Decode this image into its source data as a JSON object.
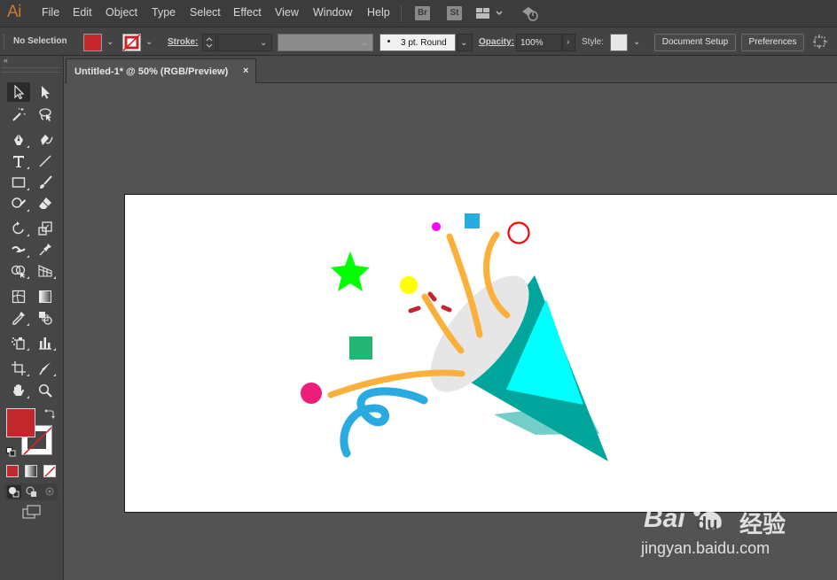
{
  "app": {
    "logo": "Ai"
  },
  "menu": {
    "items": [
      {
        "label": "File"
      },
      {
        "label": "Edit"
      },
      {
        "label": "Object"
      },
      {
        "label": "Type"
      },
      {
        "label": "Select"
      },
      {
        "label": "Effect"
      },
      {
        "label": "View"
      },
      {
        "label": "Window"
      },
      {
        "label": "Help"
      }
    ],
    "bridge_label": "Br",
    "stock_label": "St"
  },
  "control_bar": {
    "selection_status": "No Selection",
    "fill_color": "#c1272d",
    "stroke_label": "Stroke:",
    "brush_label": "3 pt. Round",
    "opacity_label": "Opacity:",
    "opacity_value": "100%",
    "style_label": "Style:",
    "document_setup_label": "Document Setup",
    "preferences_label": "Preferences"
  },
  "tools_panel": {
    "fill_color": "#c1272d",
    "tools": [
      {
        "name": "selection-tool"
      },
      {
        "name": "direct-selection-tool"
      },
      {
        "name": "magic-wand-tool"
      },
      {
        "name": "lasso-tool"
      },
      {
        "name": "pen-tool"
      },
      {
        "name": "curvature-tool"
      },
      {
        "name": "type-tool"
      },
      {
        "name": "line-segment-tool"
      },
      {
        "name": "rectangle-tool"
      },
      {
        "name": "paintbrush-tool"
      },
      {
        "name": "shaper-tool"
      },
      {
        "name": "eraser-tool"
      },
      {
        "name": "rotate-tool"
      },
      {
        "name": "scale-tool"
      },
      {
        "name": "width-tool"
      },
      {
        "name": "puppet-warp-tool"
      },
      {
        "name": "shape-builder-tool"
      },
      {
        "name": "perspective-grid-tool"
      },
      {
        "name": "mesh-tool"
      },
      {
        "name": "gradient-tool"
      },
      {
        "name": "eyedropper-tool"
      },
      {
        "name": "blend-tool"
      },
      {
        "name": "symbol-sprayer-tool"
      },
      {
        "name": "column-graph-tool"
      },
      {
        "name": "artboard-tool"
      },
      {
        "name": "slice-tool"
      },
      {
        "name": "hand-tool"
      },
      {
        "name": "zoom-tool"
      }
    ]
  },
  "document": {
    "tab_title": "Untitled-1* @ 50% (RGB/Preview)",
    "close_glyph": "×"
  },
  "artwork": {
    "colors": {
      "cone_dark": "#00a69c",
      "cone_light": "#00ffff",
      "cone_mouth": "#e6e6e6",
      "streamer_orange": "#fbb03b",
      "streamer_blue": "#29abe2",
      "star": "#00ff00",
      "square_green": "#22b573",
      "square_blue": "#29abe2",
      "dot_magenta": "#ff00ff",
      "dot_yellow": "#ffff00",
      "dot_pink": "#ed1e79",
      "ring_red": "#ff0000",
      "dashes_red": "#c1272d"
    }
  },
  "watermark": {
    "brand_a": "Bai",
    "brand_b": "du",
    "suffix": "经验",
    "url": "jingyan.baidu.com"
  }
}
